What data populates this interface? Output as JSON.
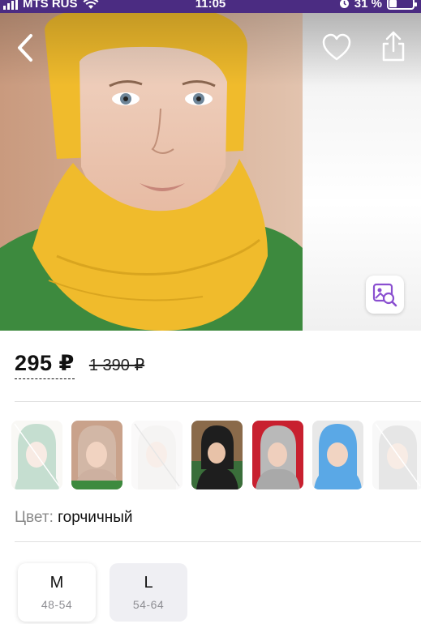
{
  "status_bar": {
    "carrier": "MTS RUS",
    "time": "11:05",
    "battery_percent": "31 %",
    "battery_level": 0.31,
    "icons": [
      "signal-icon",
      "wifi-icon",
      "alarm-icon",
      "battery-icon"
    ]
  },
  "header": {
    "icons": [
      "back-icon",
      "heart-icon",
      "share-icon",
      "visual-search-icon"
    ]
  },
  "price": {
    "current": "295 ₽",
    "old": "1 390 ₽"
  },
  "colors": {
    "label": "Цвет:",
    "selected": "горчичный",
    "swatches": [
      {
        "available": false
      },
      {
        "available": true
      },
      {
        "available": false
      },
      {
        "available": true
      },
      {
        "available": true
      },
      {
        "available": true
      },
      {
        "available": false
      }
    ]
  },
  "sizes": [
    {
      "size": "M",
      "range": "48-54",
      "selected": true
    },
    {
      "size": "L",
      "range": "54-64",
      "selected": false
    }
  ],
  "theme": {
    "status_bar_bg": "#4b2c82",
    "accent": "#8a4fd0"
  }
}
